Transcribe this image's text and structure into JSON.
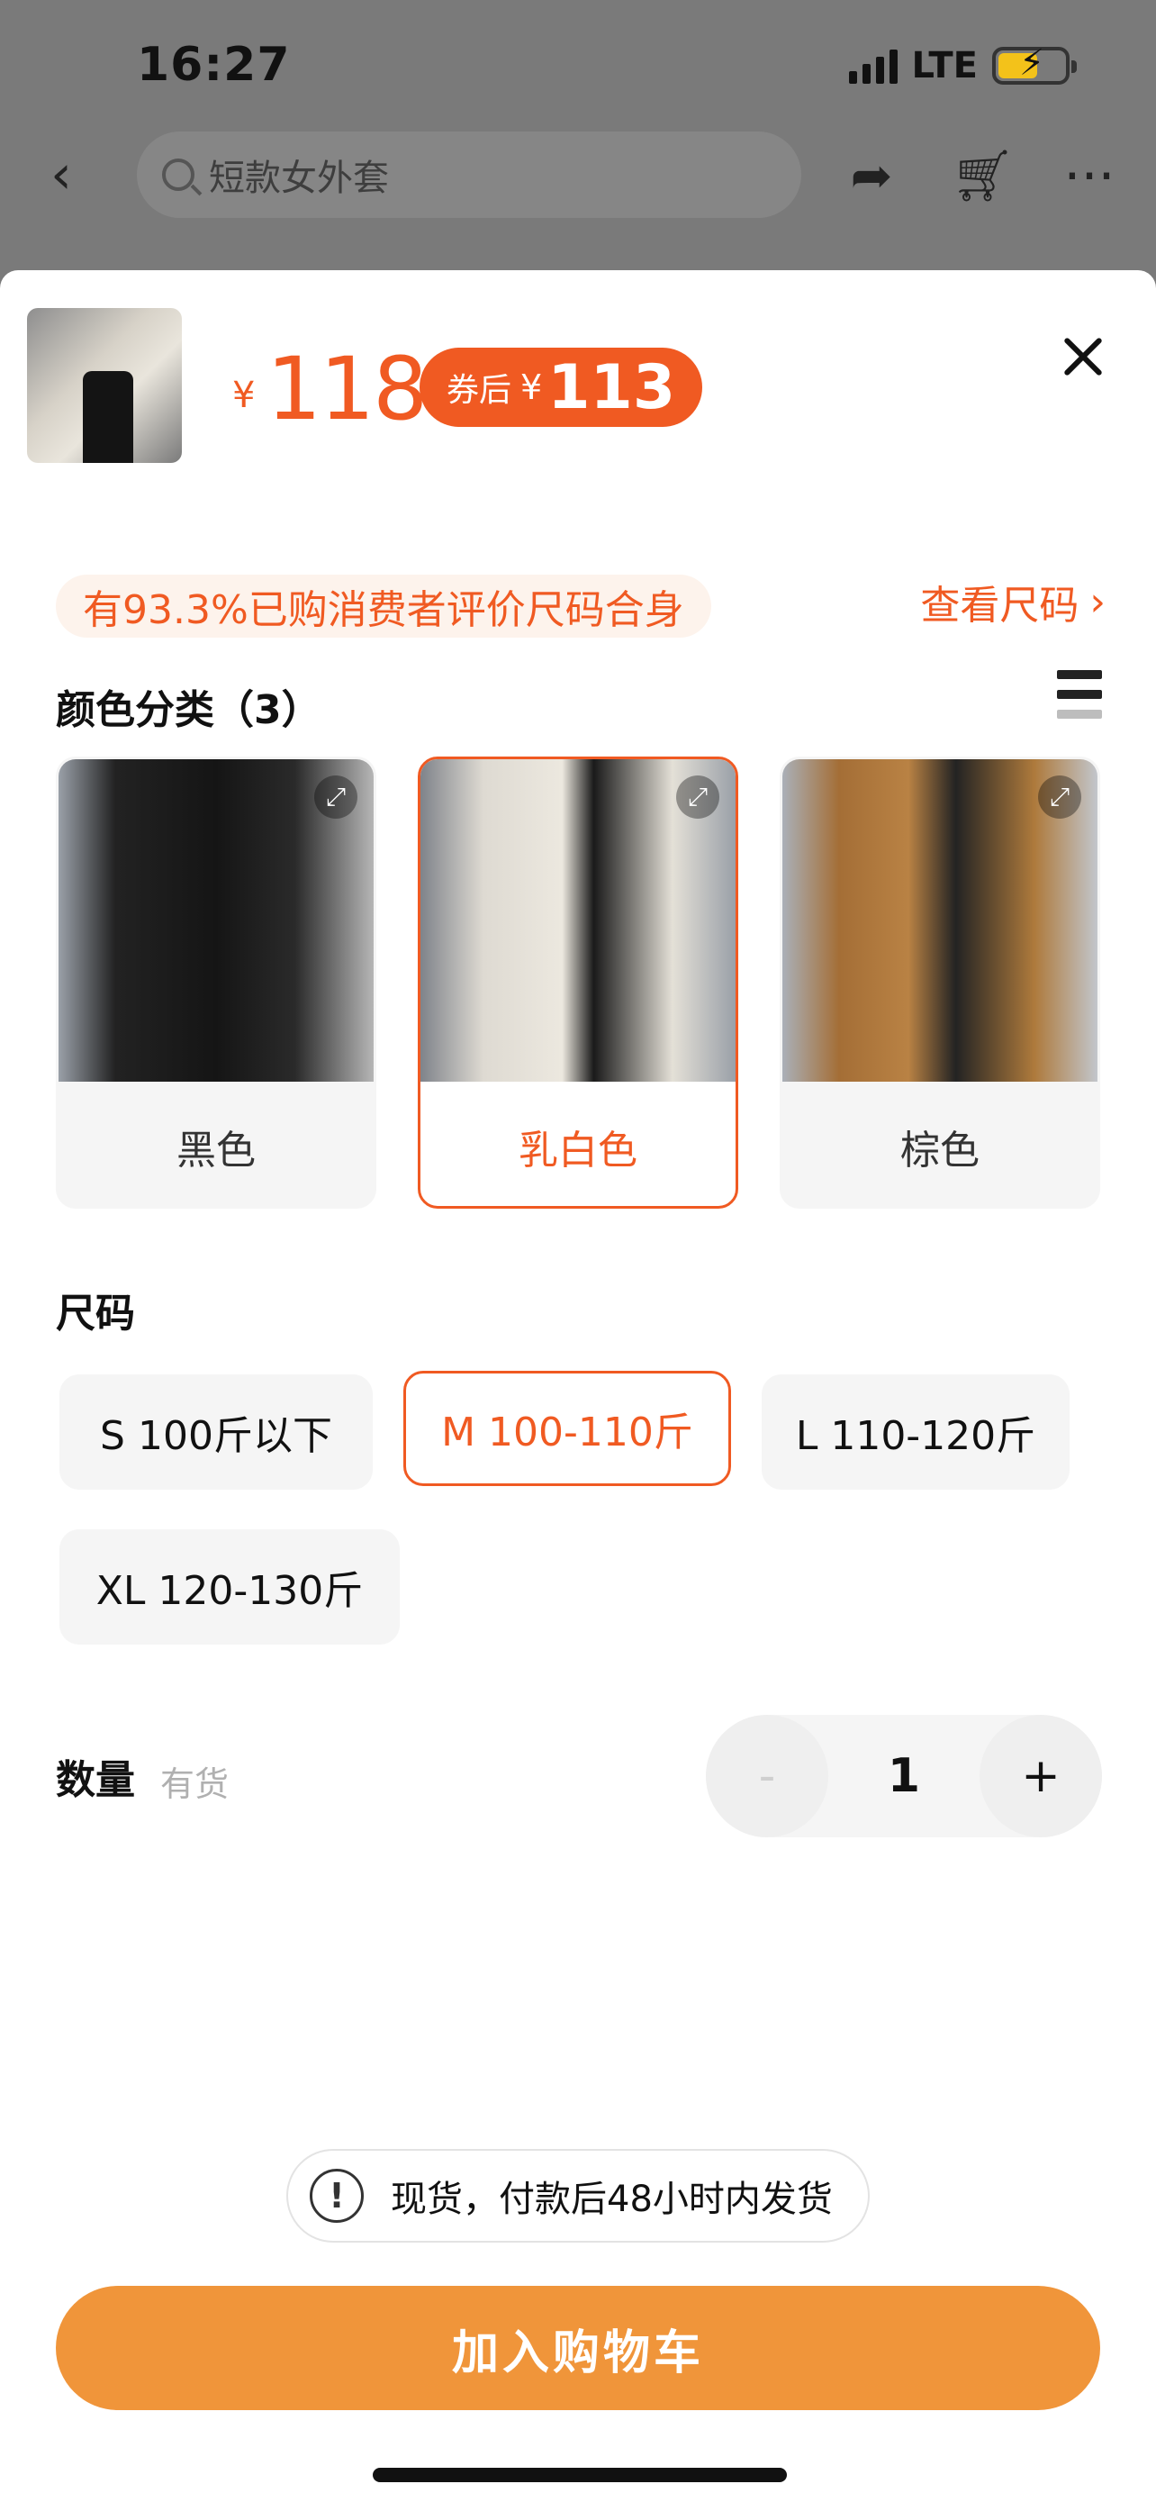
{
  "status_bar": {
    "time": "16:27",
    "network": "LTE"
  },
  "nav": {
    "search_placeholder": "短款女外套"
  },
  "product": {
    "currency": "¥",
    "price": "118",
    "coupon_label": "券后",
    "coupon_currency": "¥",
    "coupon_price": "113"
  },
  "fit": {
    "text": "有93.3%已购消费者评价尺码合身",
    "size_link": "查看尺码",
    "chevron": "›"
  },
  "colors": {
    "title": "颜色分类（3）",
    "options": [
      {
        "label": "黑色",
        "selected": false
      },
      {
        "label": "乳白色",
        "selected": true
      },
      {
        "label": "棕色",
        "selected": false
      }
    ]
  },
  "sizes": {
    "title": "尺码",
    "options": [
      {
        "label": "S 100斤以下",
        "selected": false
      },
      {
        "label": "M 100-110斤",
        "selected": true
      },
      {
        "label": "L 110-120斤",
        "selected": false
      },
      {
        "label": "XL 120-130斤",
        "selected": false
      }
    ]
  },
  "quantity": {
    "title": "数量",
    "stock": "有货",
    "minus": "-",
    "value": "1",
    "plus": "+"
  },
  "notice": {
    "icon": "!",
    "text": "现货，付款后48小时内发货"
  },
  "cta": {
    "label": "加入购物车"
  },
  "colors_theme": {
    "accent": "#f05a22",
    "cta": "#f0953a"
  }
}
